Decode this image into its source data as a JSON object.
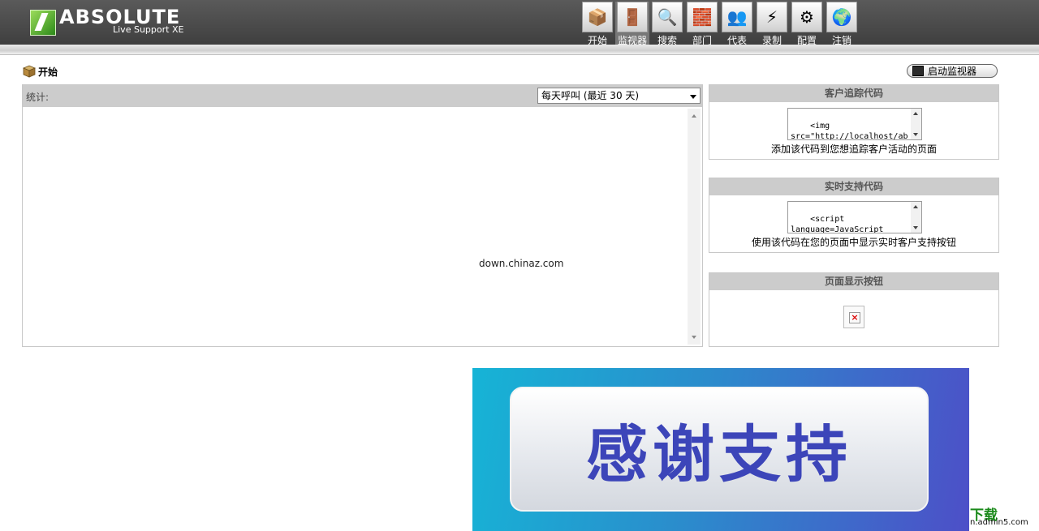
{
  "header": {
    "logo_title": "ABSOLUTE",
    "logo_subtitle": "Live Support XE",
    "nav": [
      {
        "label": "开始",
        "icon": "box-icon",
        "glyph": "📦"
      },
      {
        "label": "监视器",
        "icon": "monitor-icon",
        "glyph": "🚪"
      },
      {
        "label": "搜索",
        "icon": "search-icon",
        "glyph": "🔍"
      },
      {
        "label": "部门",
        "icon": "departments-icon",
        "glyph": "🧱"
      },
      {
        "label": "代表",
        "icon": "representatives-icon",
        "glyph": "👥"
      },
      {
        "label": "录制",
        "icon": "record-icon",
        "glyph": "⚡"
      },
      {
        "label": "配置",
        "icon": "settings-icon",
        "glyph": "⚙"
      },
      {
        "label": "注销",
        "icon": "logout-globe-icon",
        "glyph": "🌍"
      }
    ],
    "active_nav": 1
  },
  "page": {
    "title": "开始",
    "start_monitor_button": "启动监视器"
  },
  "stats": {
    "label": "统计:",
    "select_value": "每天呼叫 (最近 30 天)",
    "watermark": "down.chinaz.com"
  },
  "tracking_box": {
    "title": "客户追踪代码",
    "code": "<img\nsrc=\"http://localhost/absolutels/vtrack.asp?",
    "caption": "添加该代码到您想追踪客户活动的页面"
  },
  "live_support_box": {
    "title": "实时支持代码",
    "code": "<script\nlanguage=JavaScript\nsrc=\"http://localhost/a",
    "caption": "使用该代码在您的页面中显示实时客户支持按钮"
  },
  "button_box": {
    "title": "页面显示按钮"
  },
  "banner": {
    "text": "感谢支持"
  },
  "corner_brand": {
    "main": "下载",
    "sub": "n.admin5.com"
  },
  "colors": {
    "header_bg": "#4a4a4a",
    "panel_header": "#cccccc",
    "banner_text": "#3c45b9",
    "brand_green": "#1a8a1a"
  }
}
